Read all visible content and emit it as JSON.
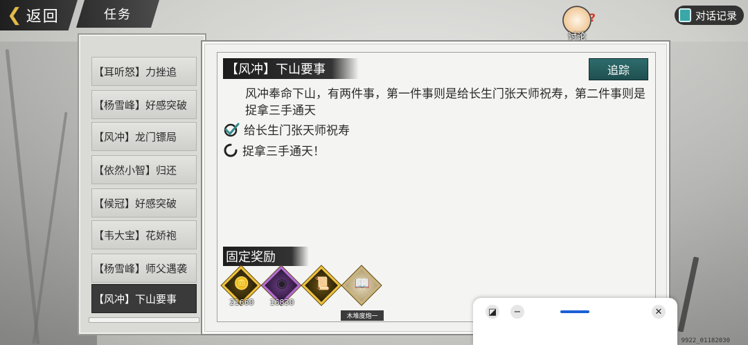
{
  "topbar": {
    "back_label": "返回",
    "title": "任务",
    "discuss_label": "讨论",
    "dialog_log_label": "对话记录"
  },
  "quest_list": [
    {
      "label": "【耳听怒】力挫追"
    },
    {
      "label": "【杨雪峰】好感突破"
    },
    {
      "label": "【风冲】龙门镖局"
    },
    {
      "label": "【依然小智】归还"
    },
    {
      "label": "【候冠】好感突破"
    },
    {
      "label": "【韦大宝】花娇袍"
    },
    {
      "label": "【杨雪峰】师父遇袭"
    },
    {
      "label": "【风冲】下山要事",
      "active": true
    }
  ],
  "detail": {
    "title": "【风冲】下山要事",
    "track_label": "追踪",
    "description": "风冲奉命下山，有两件事，第一件事则是给长生门张天师祝寿，第二件事则是捉拿三手通天",
    "objectives": [
      {
        "text": "给长生门张天师祝寿",
        "status": "done"
      },
      {
        "text": "捉拿三手通天！",
        "status": "pending"
      }
    ],
    "reward_header": "固定奖励",
    "rewards": [
      {
        "icon": "silver-coin-icon",
        "qty": "21660",
        "color": "#f0c23a"
      },
      {
        "icon": "copper-coin-icon",
        "qty": "16830",
        "color": "#b46ad6"
      },
      {
        "icon": "scroll-icon",
        "qty": "",
        "color": "#f0c23a"
      },
      {
        "icon": "manual-book-icon",
        "qty": "",
        "name": "木堆度炮一",
        "color": "#c9b27a"
      }
    ]
  },
  "overlay": {
    "build_id": "9922_01182030"
  },
  "colors": {
    "accent_teal": "#2e6c6c",
    "gold": "#e4b94a",
    "ink": "#1c1c1c",
    "handle_blue": "#1a5fd6"
  }
}
